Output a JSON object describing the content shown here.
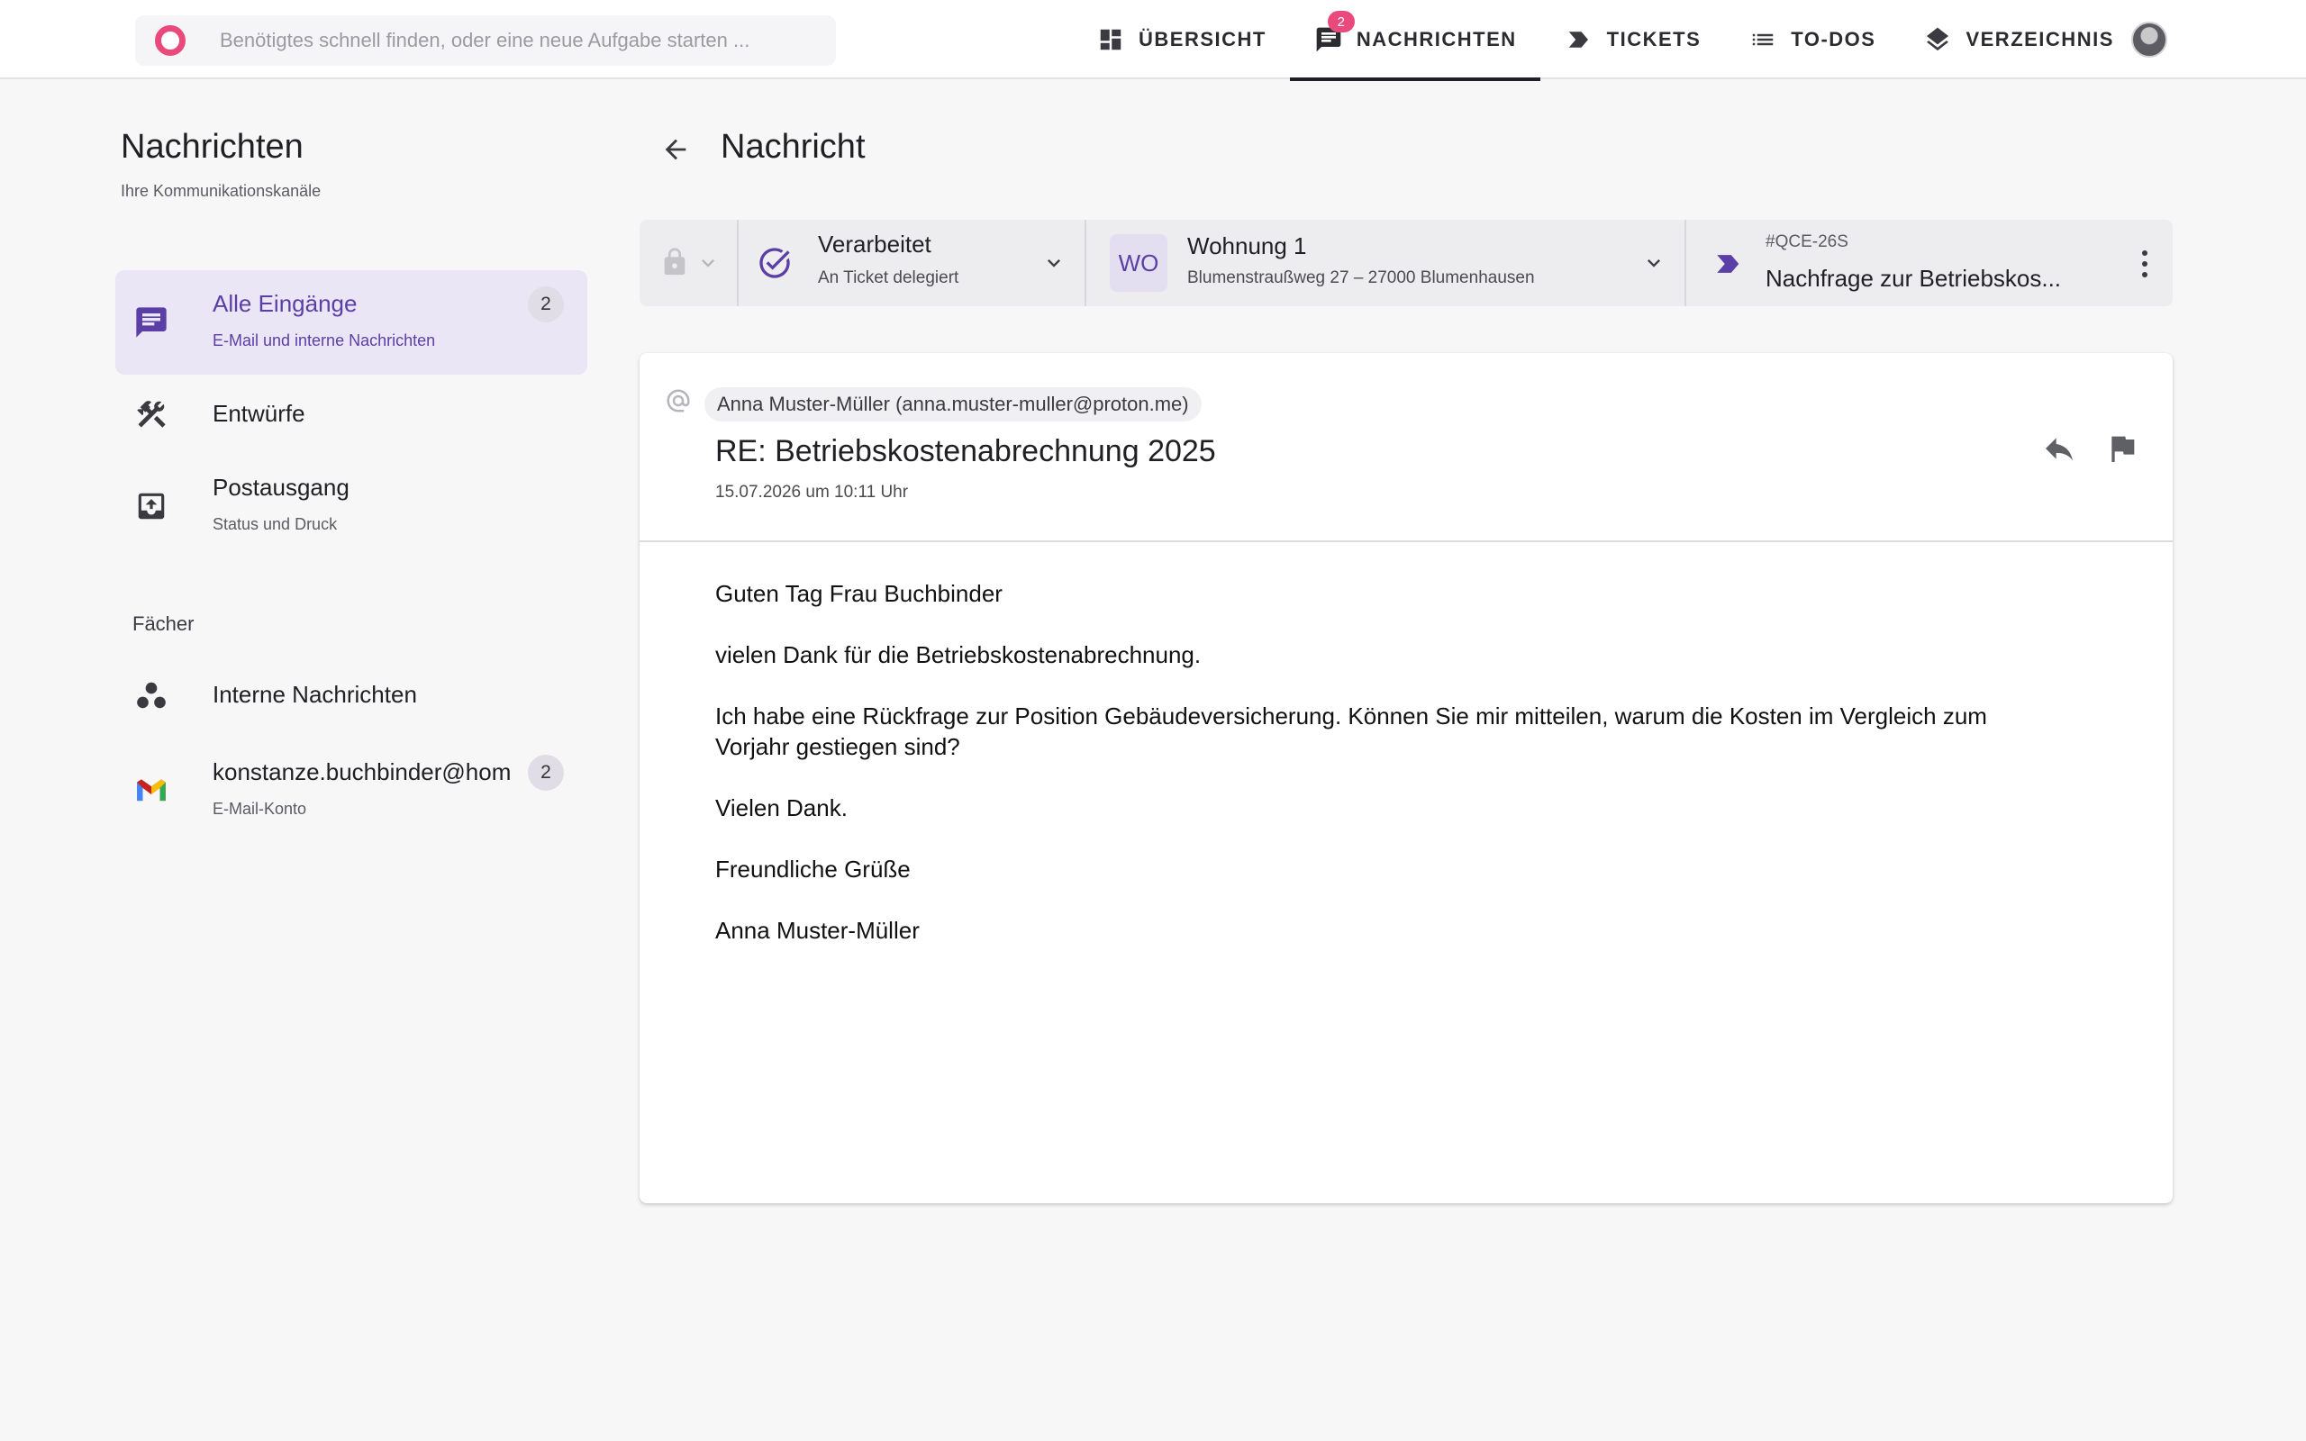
{
  "search": {
    "placeholder": "Benötigtes schnell finden, oder eine neue Aufgabe starten ..."
  },
  "nav": {
    "items": [
      {
        "label": "ÜBERSICHT",
        "icon": "dashboard-icon"
      },
      {
        "label": "NACHRICHTEN",
        "icon": "chat-icon",
        "badge": "2",
        "active": true
      },
      {
        "label": "TICKETS",
        "icon": "ticket-icon"
      },
      {
        "label": "TO-DOS",
        "icon": "list-icon"
      },
      {
        "label": "VERZEICHNIS",
        "icon": "layers-icon"
      }
    ]
  },
  "sidebar": {
    "title": "Nachrichten",
    "subtitle": "Ihre Kommunikationskanäle",
    "items": [
      {
        "label": "Alle Eingänge",
        "sub": "E-Mail und interne Nachrichten",
        "count": "2",
        "icon": "message-icon"
      },
      {
        "label": "Entwürfe",
        "icon": "draft-tools-icon"
      },
      {
        "label": "Postausgang",
        "sub": "Status und Druck",
        "icon": "outbox-icon"
      }
    ],
    "section_label": "Fächer",
    "folders": [
      {
        "label": "Interne Nachrichten",
        "icon": "group-dots-icon"
      },
      {
        "label": "konstanze.buchbinder@hom",
        "sub": "E-Mail-Konto",
        "count": "2",
        "icon": "gmail-icon"
      }
    ]
  },
  "main": {
    "title": "Nachricht",
    "toolbar": {
      "status": {
        "title": "Verarbeitet",
        "sub": "An Ticket delegiert"
      },
      "unit": {
        "badge": "WO",
        "title": "Wohnung 1",
        "sub": "Blumenstraußweg 27 – 27000 Blumenhausen"
      },
      "ticket": {
        "id": "#QCE-26S",
        "title": "Nachfrage zur Betriebskos..."
      }
    },
    "message": {
      "sender": "Anna Muster-Müller (anna.muster-muller@proton.me)",
      "subject": "RE: Betriebskostenabrechnung 2025",
      "date": "15.07.2026 um 10:11 Uhr",
      "body": [
        "Guten Tag Frau Buchbinder",
        "vielen Dank für die Betriebskostenabrechnung.",
        "Ich habe eine Rückfrage zur Position Gebäudeversicherung. Können Sie mir mitteilen, warum die Kosten im Vergleich zum Vorjahr gestiegen sind?",
        "Vielen Dank.",
        "Freundliche Grüße",
        "Anna Muster-Müller"
      ]
    }
  },
  "colors": {
    "accent": "#5b3fa6",
    "badge": "#e94a7b",
    "active_bg": "#ebe6f5"
  }
}
